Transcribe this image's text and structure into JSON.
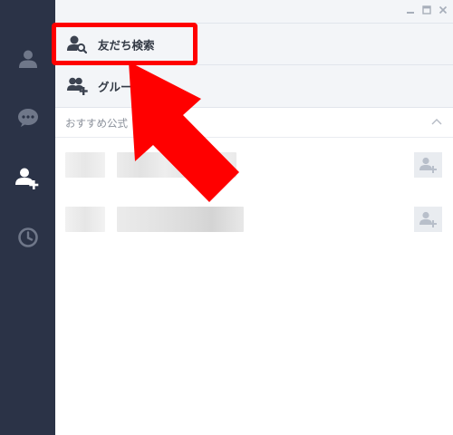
{
  "window": {
    "controls": [
      "minimize-icon",
      "maximize-icon",
      "close-icon"
    ]
  },
  "sidebar": {
    "items": [
      {
        "icon": "person-icon",
        "active": false
      },
      {
        "icon": "chat-bubble-icon",
        "active": false
      },
      {
        "icon": "add-friend-icon",
        "active": true
      },
      {
        "icon": "clock-icon",
        "active": false
      }
    ]
  },
  "menu": {
    "search_friends_label": "友だち検索",
    "create_group_label": "グルー"
  },
  "recommended": {
    "section_label": "おすすめ公式",
    "accounts": [
      {
        "name": "(blurred)",
        "action": "add-friend-button"
      },
      {
        "name": "(blurred)",
        "action": "add-friend-button"
      }
    ]
  },
  "colors": {
    "sidebar_bg": "#2b3347",
    "sidebar_icon": "#6f7789",
    "sidebar_icon_active": "#ffffff",
    "panel_bg": "#f3f5f8",
    "annotation_red": "#ff0000"
  }
}
